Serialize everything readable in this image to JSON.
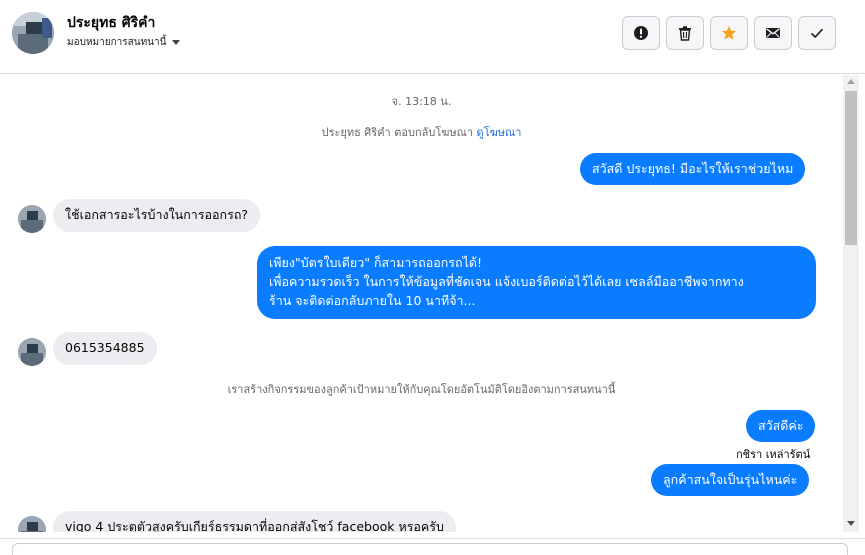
{
  "header": {
    "name": "ประยุทธ ศิริคำ",
    "assign_label": "มอบหมายการสนทนานี้",
    "actions": [
      {
        "name": "mark-spam",
        "icon": "exclamation-icon"
      },
      {
        "name": "delete",
        "icon": "trash-icon"
      },
      {
        "name": "star",
        "icon": "star-icon"
      },
      {
        "name": "mark-unread",
        "icon": "envelope-icon"
      },
      {
        "name": "done",
        "icon": "check-icon"
      }
    ],
    "accent_star": "#f5a623"
  },
  "thread": {
    "timestamp": "จ. 13:18 น.",
    "ad_reply_text": "ประยุทธ ศิริคำ ตอบกลับโฆษณา",
    "ad_link": "ดูโฆษณา",
    "msg1_out": "สวัสดี ประยุทธ! มีอะไรให้เราช่วยไหม",
    "msg2_in": "ใช้เอกสารอะไรบ้างในการออกรถ?",
    "msg3_out_line1": "เพียง\"บัตรใบเดียว\" ก็สามารถออกรถได้!",
    "msg3_out_line2": "เพื่อความรวดเร็ว ในการให้ข้อมูลที่ชัดเจน แจ้งเบอร์ติดต่อไว้ได้เลย เซลล์มืออาชีพจากทาง",
    "msg3_out_line3": "ร้าน จะติดต่อกลับภายใน 10 นาทีจ้า...",
    "msg4_in": "0615354885",
    "system_note": "เราสร้างกิจกรรมของลูกค้าเป้าหมายให้กับคุณโดยอัตโนมัติโดยอิงตามการสนทนานี้",
    "msg5_out": "สวัสดีค่ะ",
    "msg5_sender": "กชิรา เหล่ารัตน์",
    "msg6_out": "ลูกค้าสนใจเป็นรุ่นไหนค่ะ",
    "msg7_in": "vigo 4 ประตูตัวสูงครับเกียร์ธรรมดาที่ออกสู่สังโชว์ facebook หรอครับ"
  },
  "colors": {
    "outgoing_bubble": "#0a7cff",
    "incoming_bubble": "#ebedf0",
    "link": "#216fdb"
  }
}
